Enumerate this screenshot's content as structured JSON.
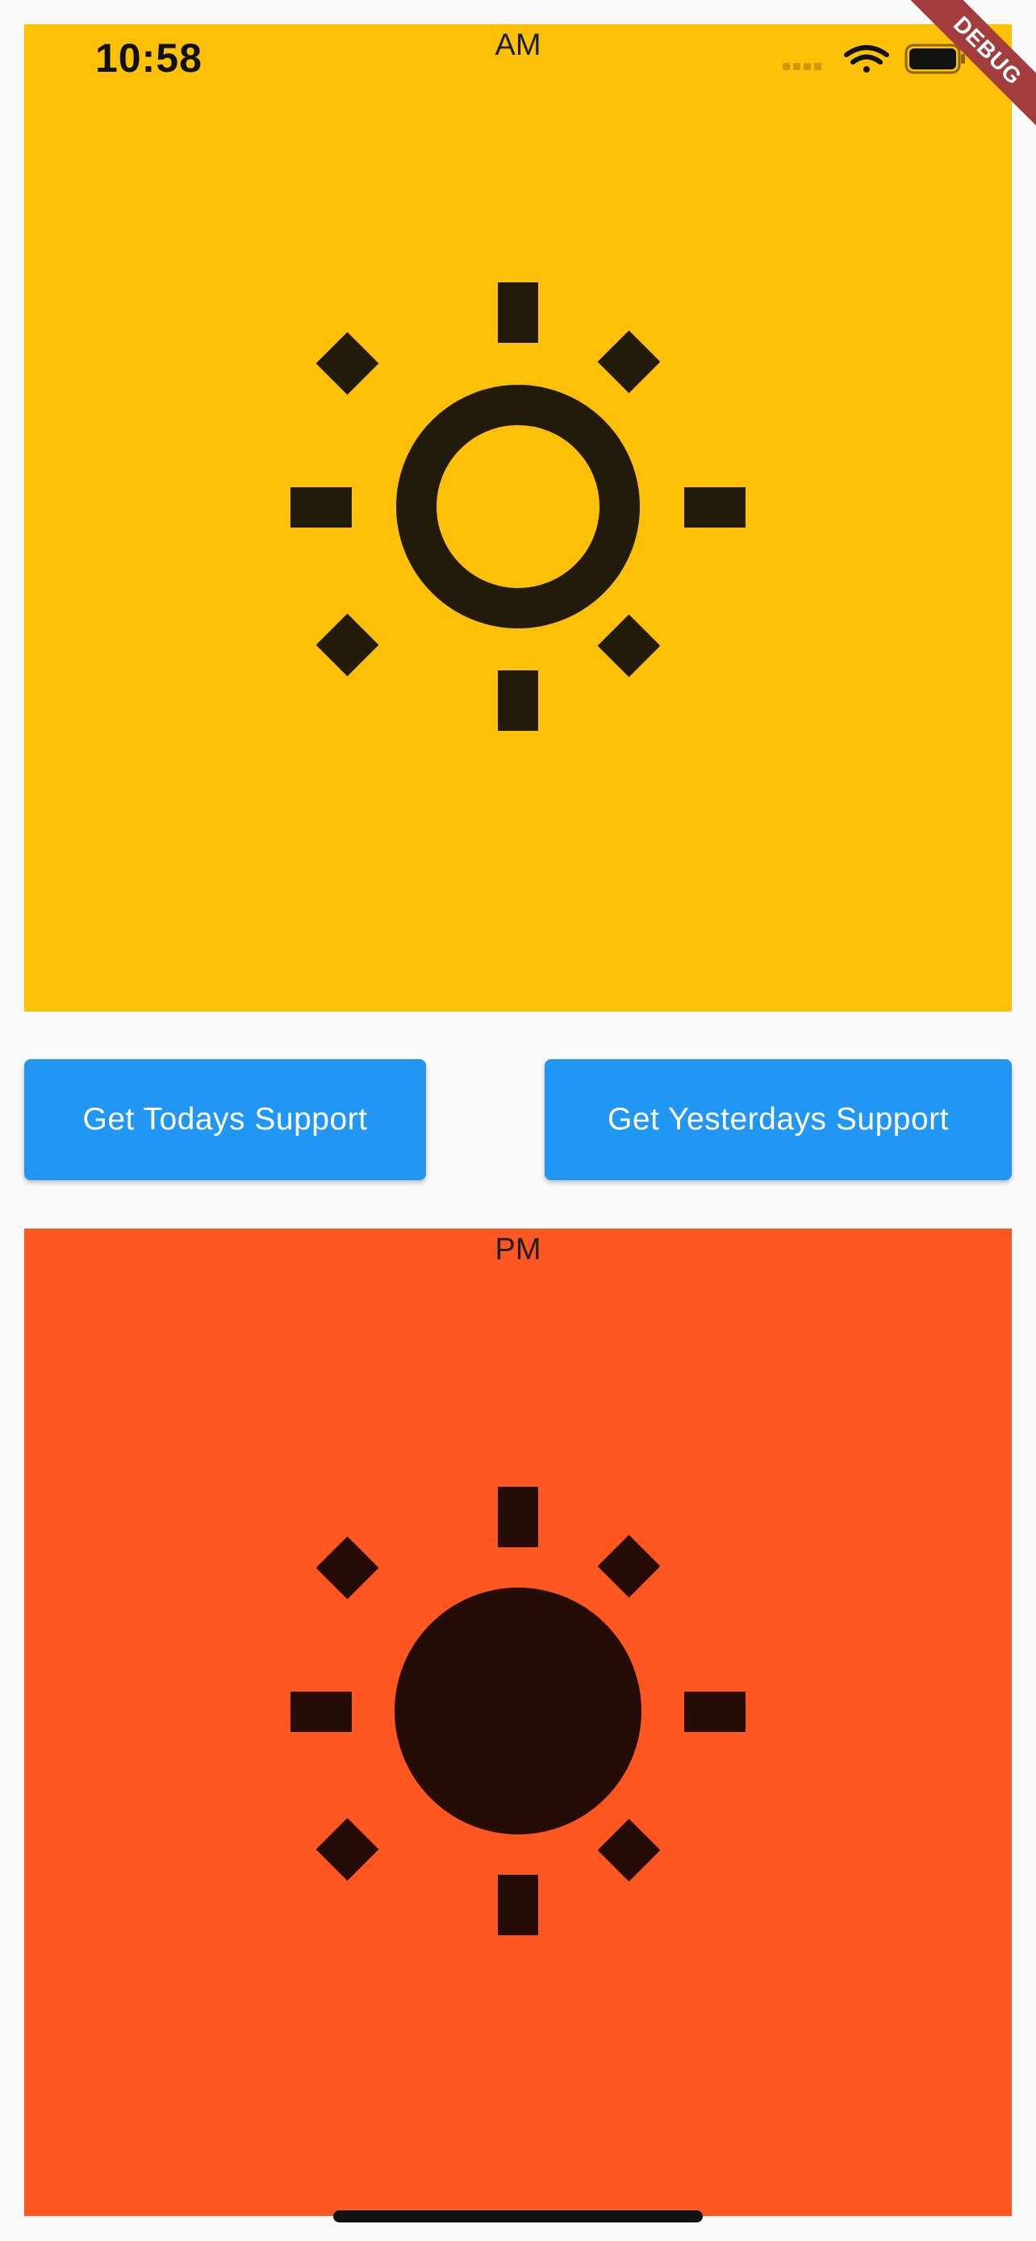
{
  "status_bar": {
    "time": "10:58"
  },
  "debug_banner": {
    "label": "DEBUG"
  },
  "am_panel": {
    "label": "AM",
    "background": "#FFC107",
    "icon": "sun-outline-icon",
    "icon_color": "#221B0A"
  },
  "buttons": {
    "today_label": "Get Todays Support",
    "yesterday_label": "Get Yesterdays Support",
    "color": "#2196F3"
  },
  "pm_panel": {
    "label": "PM",
    "background": "#FF5722",
    "icon": "sun-filled-icon",
    "icon_color": "#260C06"
  }
}
